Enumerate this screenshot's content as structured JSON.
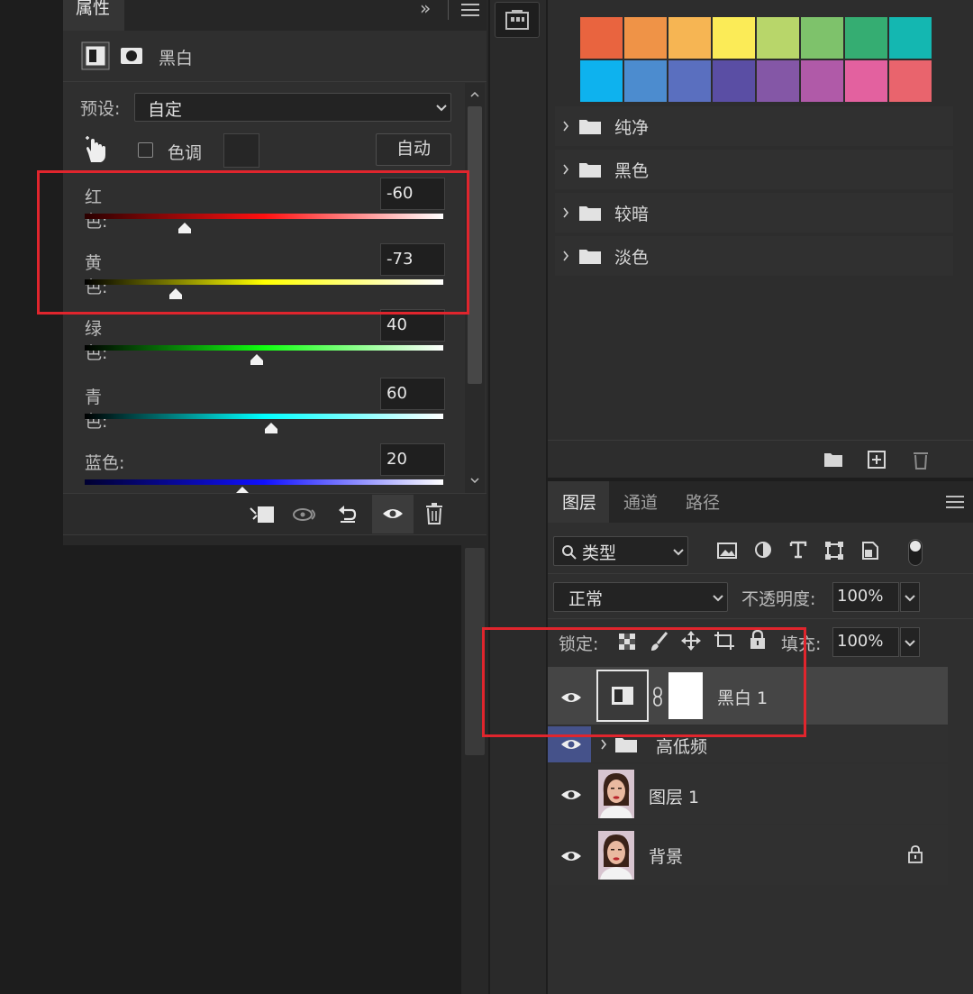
{
  "properties": {
    "tab_label": "属性",
    "collapse_glyph": "»",
    "header_title": "黑白",
    "preset_label": "预设:",
    "preset_value": "自定",
    "tint_label": "色调",
    "auto_label": "自动",
    "sliders": [
      {
        "label": "红色:",
        "value": "-60",
        "level": -60,
        "gradient": [
          "#2a0000",
          "#ff1010",
          "#ffffff"
        ]
      },
      {
        "label": "黄色:",
        "value": "-73",
        "level": -73,
        "gradient": [
          "#000000",
          "#ffff00",
          "#ffffff"
        ]
      },
      {
        "label": "绿色:",
        "value": "40",
        "level": 40,
        "gradient": [
          "#000000",
          "#10ff10",
          "#ffffff"
        ]
      },
      {
        "label": "青色:",
        "value": "60",
        "level": 60,
        "gradient": [
          "#000000",
          "#00ffff",
          "#ffffff"
        ]
      },
      {
        "label": "蓝色:",
        "value": "20",
        "level": 20,
        "gradient": [
          "#000030",
          "#1010ff",
          "#ffffff"
        ]
      }
    ],
    "bottom_toolbar": [
      "clip-to-layer-icon",
      "view-previous-icon",
      "reset-icon",
      "visibility-icon",
      "trash-icon"
    ]
  },
  "swatches": {
    "row1": [
      "#e9643f",
      "#ef9347",
      "#f6b553",
      "#fbeb57",
      "#b8d66a",
      "#7ec26b",
      "#35ad72",
      "#14b7b1"
    ],
    "row2": [
      "#0eb2ee",
      "#4c8ccf",
      "#5a6fbf",
      "#5a4ea4",
      "#8457a6",
      "#b05aa8",
      "#e3619f",
      "#e9646d"
    ],
    "folders": [
      "纯净",
      "黑色",
      "较暗",
      "淡色"
    ]
  },
  "layers_panel": {
    "tabs": [
      "图层",
      "通道",
      "路径"
    ],
    "filter_label": "类型",
    "blend_mode": "正常",
    "opacity_label": "不透明度:",
    "opacity_value": "100%",
    "lock_label": "锁定:",
    "fill_label": "填充:",
    "fill_value": "100%",
    "layers": [
      {
        "name": "黑白 1",
        "kind": "adjustment"
      },
      {
        "name": "高低频",
        "kind": "group"
      },
      {
        "name": "图层 1",
        "kind": "photo"
      },
      {
        "name": "背景",
        "kind": "photo-locked"
      }
    ]
  },
  "colors": {
    "annotation_red": "#e0252d",
    "panel_bg": "#2f2f2f",
    "selected_layer": "#454545"
  }
}
